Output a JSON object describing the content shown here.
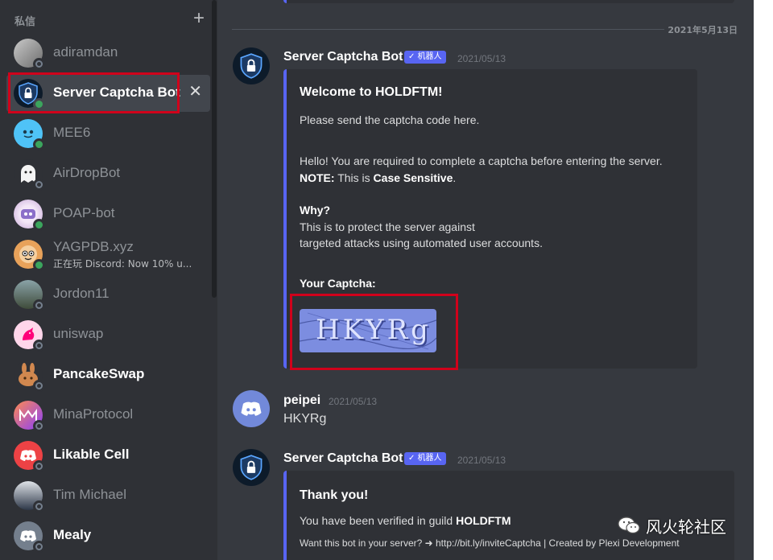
{
  "sidebar": {
    "header_title": "私信",
    "add_icon": "plus-icon",
    "close_icon": "close-icon",
    "items": [
      {
        "name": "adiramdan",
        "status": "offline",
        "avatar": "photo-avatar",
        "bright": false
      },
      {
        "name": "Server Captcha Bot",
        "status": "online",
        "avatar": "shield-lock-avatar",
        "bright": true,
        "selected": true
      },
      {
        "name": "MEE6",
        "status": "online",
        "avatar": "mee6-avatar",
        "bright": false
      },
      {
        "name": "AirDropBot",
        "status": "offline",
        "avatar": "ghost-avatar",
        "bright": false
      },
      {
        "name": "POAP-bot",
        "status": "online",
        "avatar": "poap-avatar",
        "bright": false
      },
      {
        "name": "YAGPDB.xyz",
        "sub": "正在玩 Discord: Now 10% u...",
        "status": "online",
        "avatar": "yag-avatar",
        "bright": false
      },
      {
        "name": "Jordon11",
        "status": "offline",
        "avatar": "photo-avatar",
        "bright": false
      },
      {
        "name": "uniswap",
        "status": "offline",
        "avatar": "unicorn-avatar",
        "bright": false
      },
      {
        "name": "PancakeSwap",
        "status": "offline",
        "avatar": "bunny-avatar",
        "bright": true
      },
      {
        "name": "MinaProtocol",
        "status": "offline",
        "avatar": "mina-avatar",
        "bright": false
      },
      {
        "name": "Likable Cell",
        "status": "offline",
        "avatar": "discord-avatar",
        "bright": true
      },
      {
        "name": "Tim Michael",
        "status": "offline",
        "avatar": "photo-avatar",
        "bright": false
      },
      {
        "name": "Mealy",
        "status": "offline",
        "avatar": "discord-avatar",
        "bright": true
      }
    ]
  },
  "chat": {
    "date_divider": "2021年5月13日",
    "messages": [
      {
        "author": "Server Captcha Bot",
        "bot_tag": "✓ 机器人",
        "time": "2021/05/13",
        "embed": {
          "title": "Welcome to HOLDFTM!",
          "line1": "Please send the captcha code here.",
          "line2": "Hello! You are required to complete a captcha before entering the server.",
          "note_label": "NOTE:",
          "note_mid": " This is ",
          "note_bold": "Case Sensitive",
          "note_end": ".",
          "why_label": "Why?",
          "why1": "This is to protect the server against",
          "why2": "targeted attacks using automated user accounts.",
          "captcha_label": "Your Captcha:",
          "captcha_text": "HKYRg"
        }
      },
      {
        "author": "peipei",
        "time": "2021/05/13",
        "text": "HKYRg"
      },
      {
        "author": "Server Captcha Bot",
        "bot_tag": "✓ 机器人",
        "time": "2021/05/13",
        "embed": {
          "title": "Thank you!",
          "line1_pre": "You have been verified in guild ",
          "line1_bold": "HOLDFTM",
          "footer": "Want this bot in your server? ➜ http://bit.ly/inviteCaptcha | Created by Plexi Development"
        }
      }
    ]
  },
  "watermark": {
    "text": "风火轮社区",
    "icon": "wechat-icon"
  },
  "colors": {
    "blurple": "#5865f2",
    "online": "#3ba55d",
    "highlight": "#d0021b",
    "sidebar": "#2f3136",
    "chat": "#36393f"
  }
}
